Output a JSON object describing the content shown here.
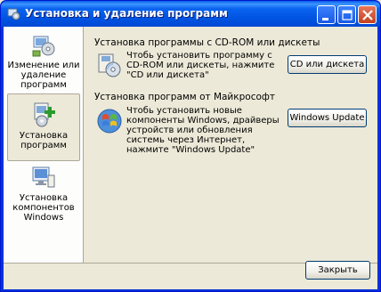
{
  "window": {
    "title": "Установка и удаление программ",
    "colors": {
      "titlebar": "#0054e3",
      "client": "#ece9d8",
      "sidebar": "#fdfdfc",
      "close": "#d24a28"
    }
  },
  "titlebar_buttons": {
    "minimize_icon": "minimize-icon",
    "maximize_icon": "maximize-icon",
    "close_icon": "close-icon"
  },
  "sidebar": {
    "items": [
      {
        "label": "Изменение или удаление программ",
        "icon": "change-remove-programs-icon",
        "selected": false
      },
      {
        "label": "Установка программ",
        "icon": "add-programs-icon",
        "selected": true
      },
      {
        "label": "Установка компонентов Windows",
        "icon": "windows-components-icon",
        "selected": false
      }
    ]
  },
  "main": {
    "cd_section": {
      "heading": "Установка программы с CD-ROM или дискеты",
      "text": "Чтобь установить программу с CD-ROM или дискеты, нажмите \"CD или дискета\"",
      "button": "CD или дискета",
      "icon": "cd-floppy-icon"
    },
    "ms_section": {
      "heading": "Установка программ от Майкрософт",
      "text": "Чтобь установить новые компоненты Windows, драйверы устройств или обновления системь через Интернет, нажмите \"Windows Update\"",
      "button": "Windows Update",
      "icon": "windows-update-icon"
    }
  },
  "footer": {
    "close_button": "Закрыть"
  }
}
